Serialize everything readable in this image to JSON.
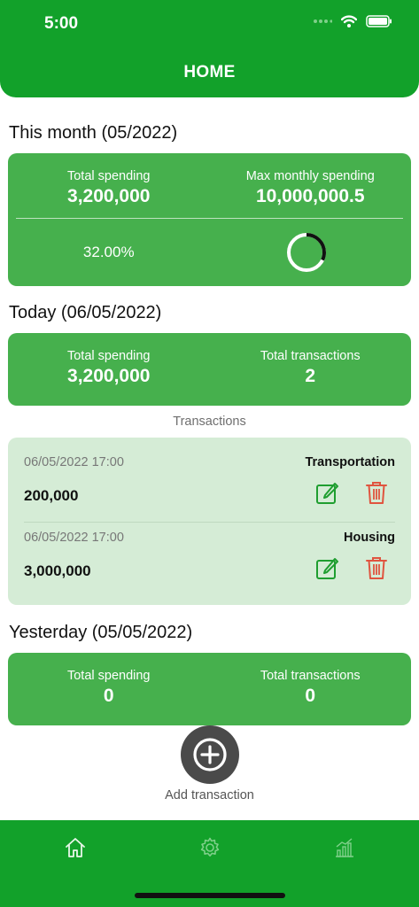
{
  "status_bar": {
    "time": "5:00"
  },
  "header": {
    "title": "HOME"
  },
  "month": {
    "title": "This month (05/2022)",
    "total_label": "Total spending",
    "total_value": "3,200,000",
    "max_label": "Max monthly spending",
    "max_value": "10,000,000.5",
    "percent": "32.00%",
    "progress_fraction": 0.32
  },
  "today": {
    "title": "Today (06/05/2022)",
    "total_label": "Total spending",
    "total_value": "3,200,000",
    "count_label": "Total transactions",
    "count_value": "2"
  },
  "transactions_heading": "Transactions",
  "transactions": [
    {
      "datetime": "06/05/2022 17:00",
      "category": "Transportation",
      "amount": "200,000"
    },
    {
      "datetime": "06/05/2022 17:00",
      "category": "Housing",
      "amount": "3,000,000"
    }
  ],
  "yesterday": {
    "title": "Yesterday (05/05/2022)",
    "total_label": "Total spending",
    "total_value": "0",
    "count_label": "Total transactions",
    "count_value": "0"
  },
  "add_transaction_label": "Add transaction",
  "nav": {
    "items": [
      "home-icon",
      "gear-icon",
      "chart-icon"
    ],
    "active": "home-icon"
  },
  "colors": {
    "header_green": "#12a12a",
    "card_green": "#46b04d",
    "panel_green": "#d5ecd6",
    "edit_green": "#1f9e30",
    "delete_red": "#e0543f"
  }
}
